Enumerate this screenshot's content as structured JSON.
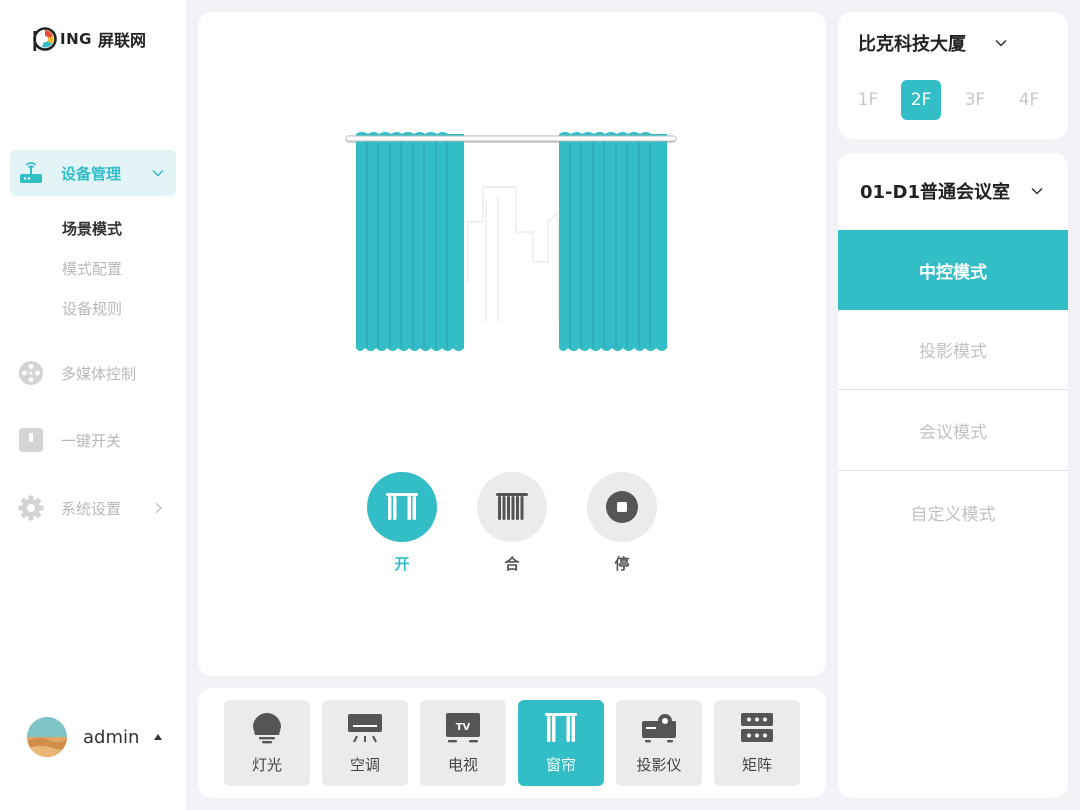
{
  "brand": {
    "mark": "P",
    "name_en": "ING",
    "name_cn": "屏联网"
  },
  "sidebar": {
    "items": [
      {
        "label": "设备管理",
        "icon": "router-icon",
        "active": true,
        "expanded": true
      },
      {
        "label": "多媒体控制",
        "icon": "film-reel-icon",
        "active": false
      },
      {
        "label": "一键开关",
        "icon": "switch-icon",
        "active": false
      },
      {
        "label": "系统设置",
        "icon": "gear-icon",
        "active": false
      }
    ],
    "sub_items": [
      {
        "label": "场景模式",
        "active": true
      },
      {
        "label": "模式配置",
        "active": false
      },
      {
        "label": "设备规则",
        "active": false
      }
    ]
  },
  "user": {
    "name": "admin"
  },
  "controls": [
    {
      "label": "开",
      "icon": "curtain-open-icon",
      "active": true
    },
    {
      "label": "合",
      "icon": "curtain-close-icon",
      "active": false
    },
    {
      "label": "停",
      "icon": "stop-icon",
      "active": false
    }
  ],
  "devices": [
    {
      "label": "灯光",
      "icon": "light-bulb-icon",
      "active": false
    },
    {
      "label": "空调",
      "icon": "air-conditioner-icon",
      "active": false
    },
    {
      "label": "电视",
      "icon": "tv-icon",
      "active": false
    },
    {
      "label": "窗帘",
      "icon": "curtain-icon",
      "active": true
    },
    {
      "label": "投影仪",
      "icon": "projector-icon",
      "active": false
    },
    {
      "label": "矩阵",
      "icon": "matrix-icon",
      "active": false
    }
  ],
  "tv_icon_text": "TV",
  "building": {
    "name": "比克科技大厦",
    "floors": [
      {
        "label": "1F",
        "active": false
      },
      {
        "label": "2F",
        "active": true
      },
      {
        "label": "3F",
        "active": false
      },
      {
        "label": "4F",
        "active": false
      }
    ]
  },
  "room": {
    "name": "01-D1普通会议室",
    "modes": [
      {
        "label": "中控模式",
        "active": true
      },
      {
        "label": "投影模式",
        "active": false
      },
      {
        "label": "会议模式",
        "active": false
      },
      {
        "label": "自定义模式",
        "active": false
      }
    ]
  },
  "colors": {
    "accent": "#33bdc7",
    "accent_light": "#e3f4f6",
    "inactive_text": "#b8b8b8",
    "tile_bg": "#ebebeb",
    "icon_dark": "#555555"
  }
}
